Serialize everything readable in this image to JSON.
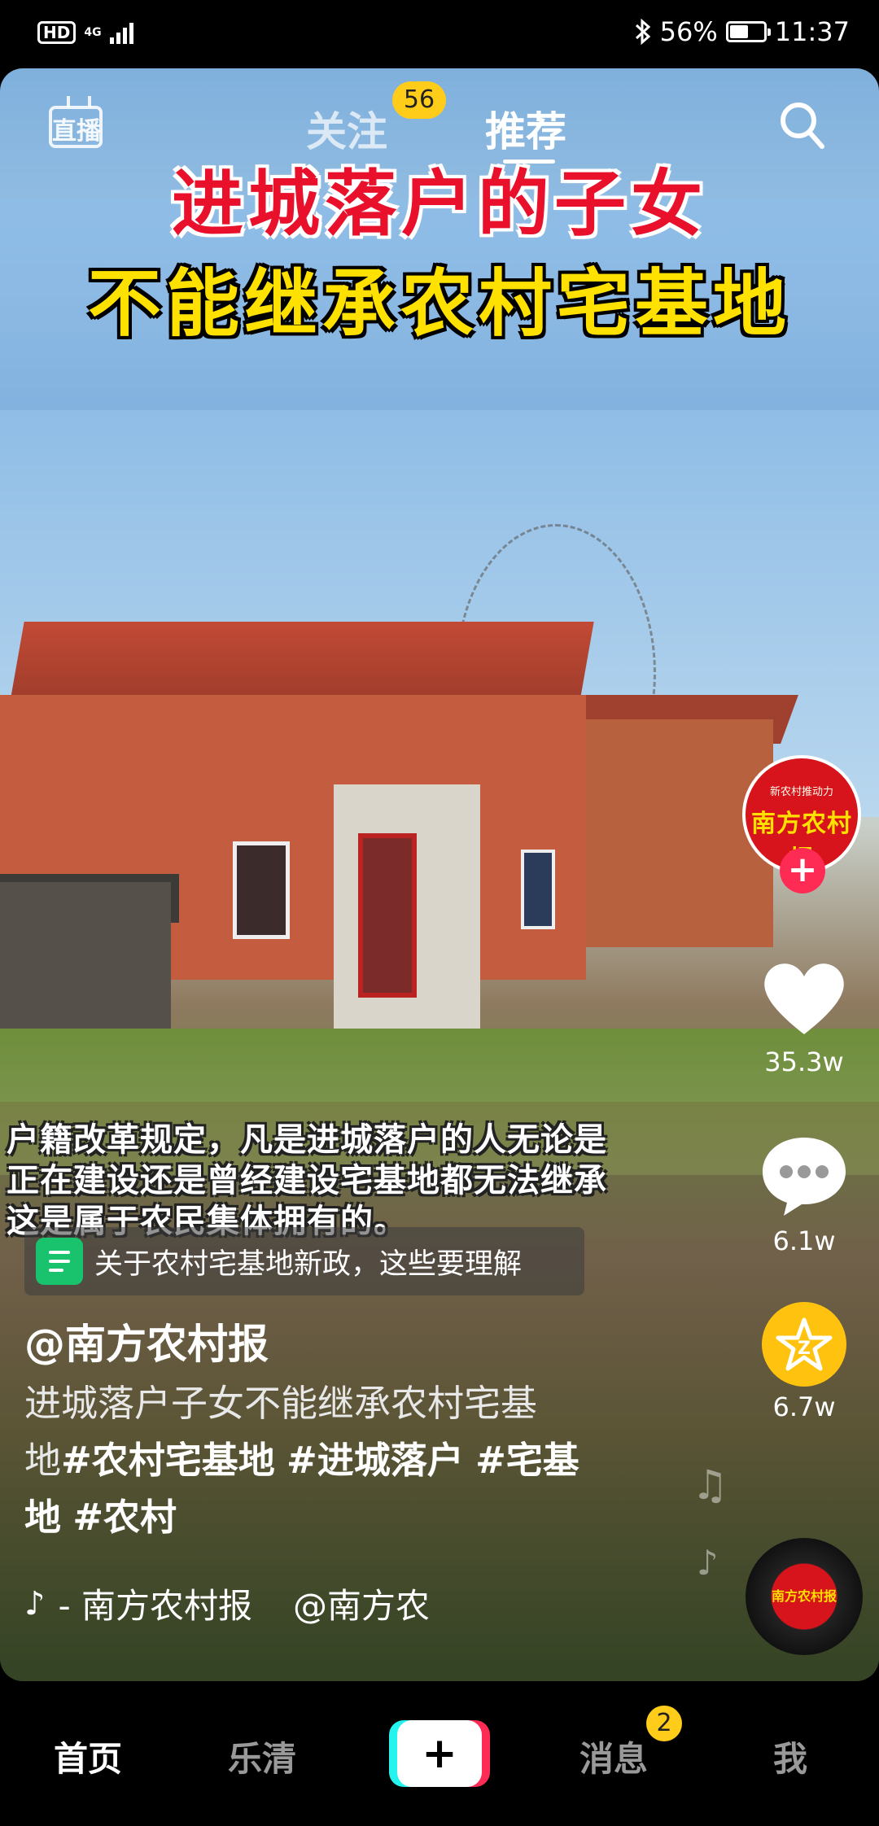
{
  "status_bar": {
    "hd": "HD",
    "network": "4G",
    "battery": "56%",
    "battery_level": 0.56,
    "time": "11:37"
  },
  "top_nav": {
    "live": "直播",
    "tabs": [
      {
        "label": "关注",
        "badge": "56"
      },
      {
        "label": "推荐",
        "active": true
      }
    ]
  },
  "video": {
    "title_line1": "进城落户的子女",
    "title_line2": "不能继承农村宅基地",
    "subtitle_lines": [
      "户籍改革规定，凡是进城落户的人无论是",
      "正在建设还是曾经建设宅基地都无法继承",
      "这是属于农民集体拥有的。"
    ],
    "notice": "关于农村宅基地新政，这些要理解",
    "author": "@南方农村报",
    "description_plain": "进城落户子女不能继承农村宅基",
    "description_tail_plain": "地",
    "hashtags": [
      "#农村宅基地",
      "#进城落户",
      "#宅基",
      "地",
      "#农村"
    ],
    "music": {
      "title": "- 南方农村报",
      "handle": "@南方农"
    }
  },
  "right_rail": {
    "avatar_small": "新农村推动力",
    "avatar_name": "南方农村报",
    "likes": "35.3w",
    "comments": "6.1w",
    "favorites": "6.7w"
  },
  "bottom_nav": {
    "items": [
      "首页",
      "乐清",
      "+",
      "消息",
      "我"
    ],
    "messages_badge": "2"
  },
  "colors": {
    "accent_red": "#fe2c55",
    "accent_cyan": "#25f4ee",
    "badge_yellow": "#ffcc1a",
    "title_red": "#e8102a",
    "title_yellow": "#ffe100"
  }
}
